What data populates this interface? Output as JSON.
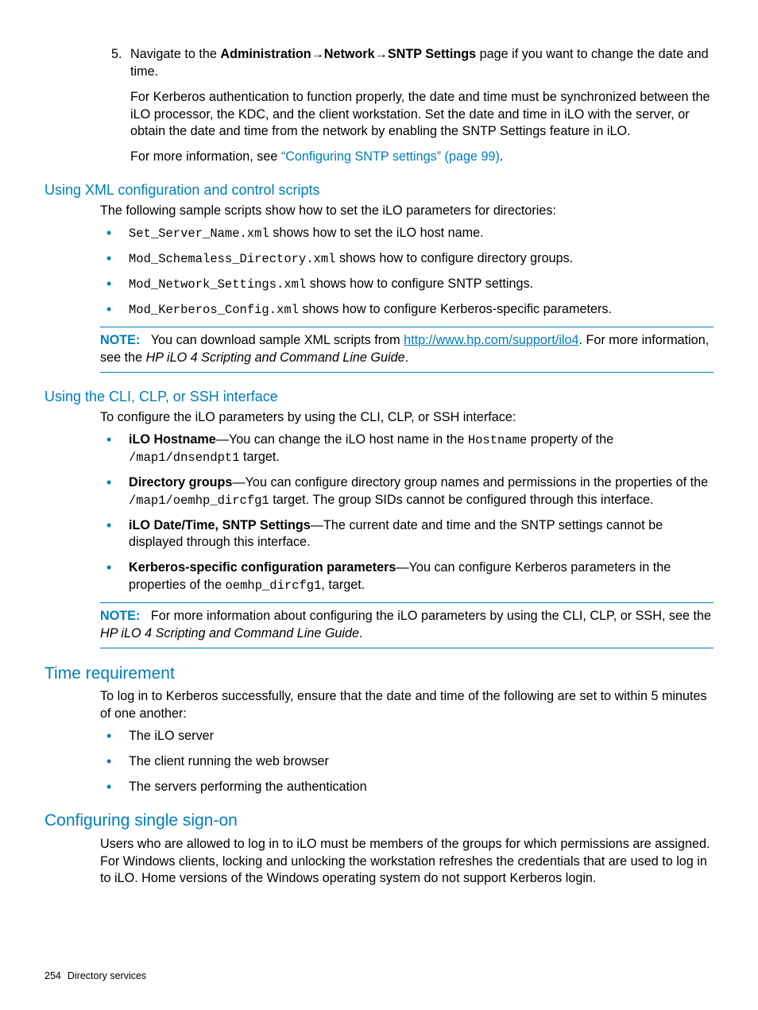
{
  "step5": {
    "num": "5.",
    "p1_a": "Navigate to the ",
    "p1_b": "Administration",
    "p1_c": "Network",
    "p1_d": "SNTP Settings",
    "p1_e": " page if you want to change the date and time.",
    "p2": "For Kerberos authentication to function properly, the date and time must be synchronized between the iLO processor, the KDC, and the client workstation. Set the date and time in iLO with the server, or obtain the date and time from the network by enabling the SNTP Settings feature in iLO.",
    "p3_a": "For more information, see ",
    "p3_b": "“Configuring SNTP settings” (page 99)",
    "p3_c": "."
  },
  "xml": {
    "title": "Using XML configuration and control scripts",
    "intro": "The following sample scripts show how to set the iLO parameters for directories:",
    "items": [
      {
        "code": "Set_Server_Name.xml",
        "rest": " shows how to set the iLO host name."
      },
      {
        "code": "Mod_Schemaless_Directory.xml",
        "rest": " shows how to configure directory groups."
      },
      {
        "code": "Mod_Network_Settings.xml",
        "rest": " shows how to configure SNTP settings."
      },
      {
        "code": "Mod_Kerberos_Config.xml",
        "rest": " shows how to configure Kerberos-specific parameters."
      }
    ],
    "note_a": "You can download sample XML scripts from ",
    "note_link": "http://www.hp.com/support/ilo4",
    "note_b": ". For more information, see the ",
    "note_i": "HP iLO 4 Scripting and Command Line Guide",
    "note_c": "."
  },
  "cli": {
    "title": "Using the CLI, CLP, or SSH interface",
    "intro": "To configure the iLO parameters by using the CLI, CLP, or SSH interface:",
    "items": {
      "i0": {
        "b": "iLO Hostname",
        "a": "—You can change the iLO host name in the ",
        "c1": "Hostname",
        "a2": " property of the ",
        "c2": "/map1/dnsendpt1",
        "a3": " target."
      },
      "i1": {
        "b": "Directory groups",
        "a": "—You can configure directory group names and permissions in the properties of the ",
        "c1": "/map1/oemhp_dircfg1",
        "a2": " target. The group SIDs cannot be configured through this interface."
      },
      "i2": {
        "b": "iLO Date/Time, SNTP Settings",
        "a": "—The current date and time and the SNTP settings cannot be displayed through this interface."
      },
      "i3": {
        "b": "Kerberos-specific configuration parameters",
        "a": "—You can configure Kerberos parameters in the properties of the ",
        "c1": "oemhp_dircfg1",
        "a2": ", target."
      }
    },
    "note_a": "For more information about configuring the iLO parameters by using the CLI, CLP, or SSH, see the ",
    "note_i": "HP iLO 4 Scripting and Command Line Guide",
    "note_b": "."
  },
  "time": {
    "title": "Time requirement",
    "intro": "To log in to Kerberos successfully, ensure that the date and time of the following are set to within 5 minutes of one another:",
    "items": [
      "The iLO server",
      "The client running the web browser",
      "The servers performing the authentication"
    ]
  },
  "sso": {
    "title": "Configuring single sign-on",
    "body": "Users who are allowed to log in to iLO must be members of the groups for which permissions are assigned. For Windows clients, locking and unlocking the workstation refreshes the credentials that are used to log in to iLO. Home versions of the Windows operating system do not support Kerberos login."
  },
  "note_label": "NOTE:",
  "arrow": "→",
  "footer": {
    "page": "254",
    "section": "Directory services"
  }
}
